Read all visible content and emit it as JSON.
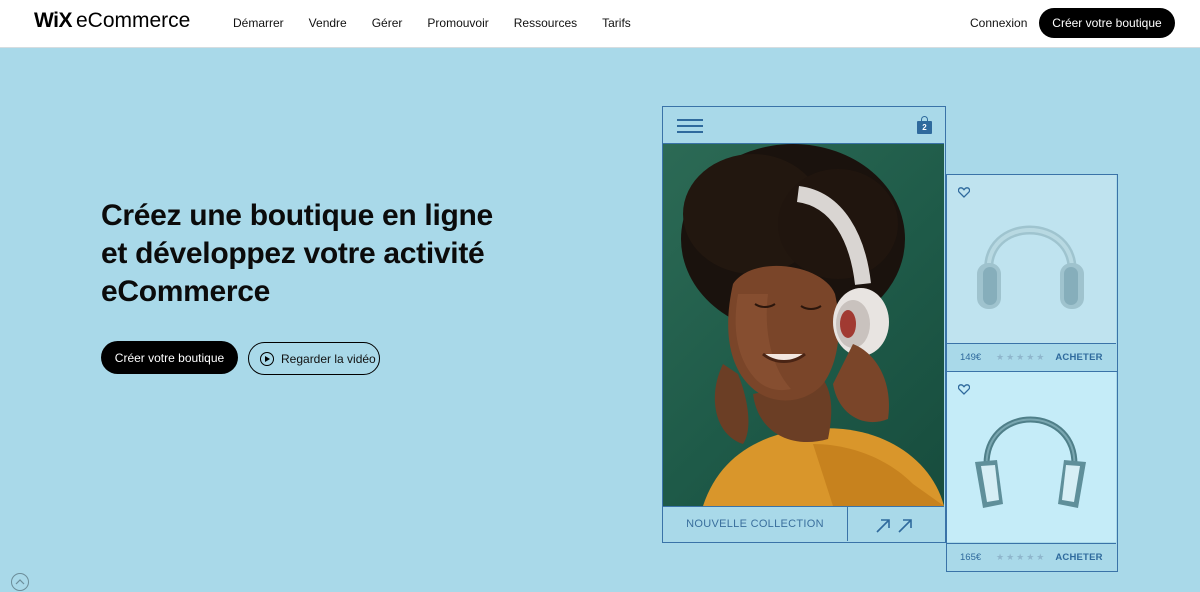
{
  "header": {
    "logo_brand": "WiX",
    "logo_product": "eCommerce",
    "nav": [
      "Démarrer",
      "Vendre",
      "Gérer",
      "Promouvoir",
      "Ressources",
      "Tarifs"
    ],
    "login": "Connexion",
    "cta": "Créer votre boutique"
  },
  "hero": {
    "title": "Créez une boutique en ligne et développez votre activité eCommerce",
    "primary_button": "Créer votre boutique",
    "video_button": "Regarder la vidéo"
  },
  "mockup": {
    "cart_count": "2",
    "collection_label": "NOUVELLE COLLECTION",
    "products": [
      {
        "price": "149€",
        "rating_stars": "★★★★★",
        "buy_label": "ACHETER"
      },
      {
        "price": "165€",
        "rating_stars": "★★★★★",
        "buy_label": "ACHETER"
      }
    ]
  },
  "colors": {
    "background": "#a9d9e9",
    "accent_blue": "#3a73a8",
    "primary_button": "#000000"
  }
}
